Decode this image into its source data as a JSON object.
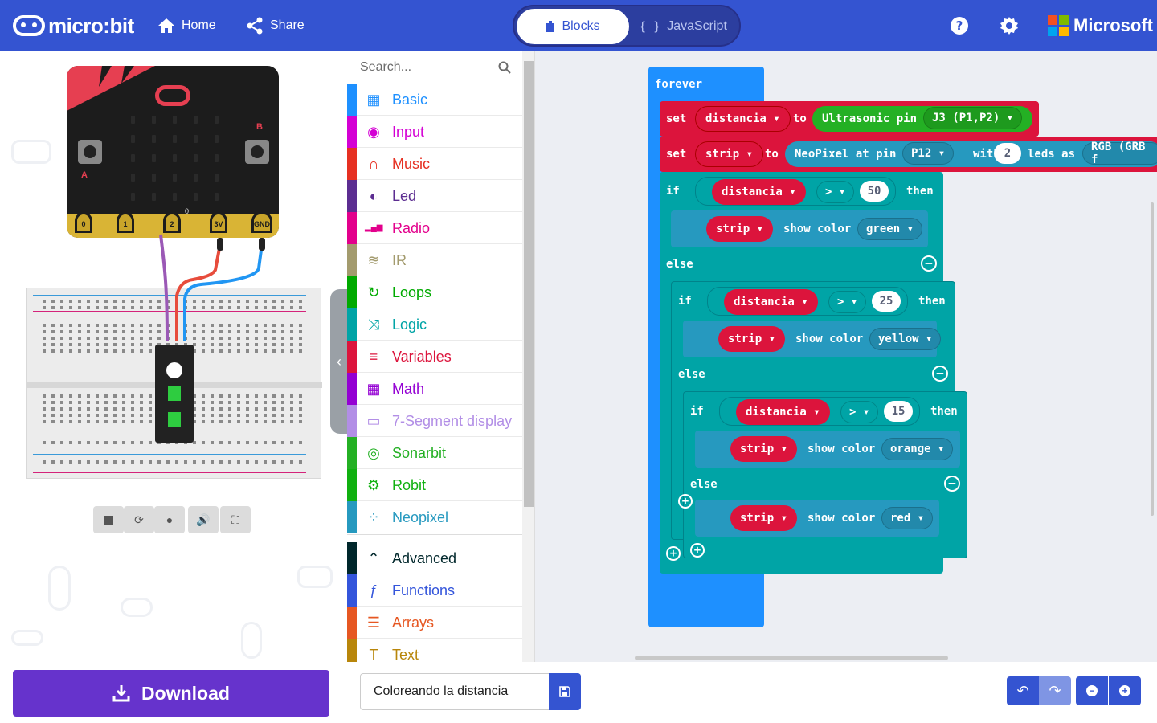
{
  "header": {
    "brand": "micro:bit",
    "home_label": "Home",
    "share_label": "Share",
    "tabs": [
      {
        "label": "Blocks",
        "active": true
      },
      {
        "label": "JavaScript",
        "active": false
      }
    ],
    "microsoft_label": "Microsoft",
    "colors": {
      "header_bg": "#3454d1",
      "toggle_active": "#ffffff"
    }
  },
  "simulator": {
    "pins": [
      "0",
      "1",
      "2",
      "3V",
      "GND"
    ],
    "button_a": "A",
    "button_b": "B",
    "pin_marker": "0"
  },
  "toolbox": {
    "search_placeholder": "Search...",
    "categories": [
      {
        "label": "Basic",
        "icon": "grid-icon",
        "color": "#1e90ff"
      },
      {
        "label": "Input",
        "icon": "target-icon",
        "color": "#d400d4"
      },
      {
        "label": "Music",
        "icon": "headphones-icon",
        "color": "#e63022"
      },
      {
        "label": "Led",
        "icon": "toggle-icon",
        "color": "#5c2d91"
      },
      {
        "label": "Radio",
        "icon": "signal-bars-icon",
        "color": "#e3008c"
      },
      {
        "label": "IR",
        "icon": "wifi-icon",
        "color": "#a39b6e"
      },
      {
        "label": "Loops",
        "icon": "refresh-icon",
        "color": "#00aa00"
      },
      {
        "label": "Logic",
        "icon": "shuffle-icon",
        "color": "#00a4a6"
      },
      {
        "label": "Variables",
        "icon": "list-lines-icon",
        "color": "#dc143c"
      },
      {
        "label": "Math",
        "icon": "calculator-icon",
        "color": "#9400d3"
      },
      {
        "label": "7-Segment display",
        "icon": "monitor-icon",
        "color": "#b28ee6"
      },
      {
        "label": "Sonarbit",
        "icon": "sonar-icon",
        "color": "#24b024"
      },
      {
        "label": "Robit",
        "icon": "gear-icon",
        "color": "#10b010"
      },
      {
        "label": "Neopixel",
        "icon": "dots-circle-icon",
        "color": "#2699bf"
      }
    ],
    "advanced": [
      {
        "label": "Advanced",
        "icon": "chevron-up-icon",
        "color": "#00272b"
      },
      {
        "label": "Functions",
        "icon": "fx-icon",
        "color": "#3455db"
      },
      {
        "label": "Arrays",
        "icon": "numbered-list-icon",
        "color": "#e65722"
      },
      {
        "label": "Text",
        "icon": "text-icon",
        "color": "#b8860b"
      }
    ]
  },
  "workspace": {
    "forever": "forever",
    "set1": {
      "set": "set",
      "var": "distancia",
      "to": "to",
      "fn": "Ultrasonic pin",
      "pin": "J3 (P1,P2)"
    },
    "set2": {
      "set": "set",
      "var": "strip",
      "to": "to",
      "fn": "NeoPixel at pin",
      "pin": "P12",
      "with": "with",
      "count": "2",
      "leds_as": "leds as",
      "mode": "RGB (GRB f"
    },
    "if1": {
      "if": "if",
      "var": "distancia",
      "op": ">",
      "value": "50",
      "then": "then",
      "strip": "strip",
      "show": "show color",
      "color": "green"
    },
    "else1": "else",
    "if2": {
      "if": "if",
      "var": "distancia",
      "op": ">",
      "value": "25",
      "then": "then",
      "strip": "strip",
      "show": "show color",
      "color": "yellow"
    },
    "else2": "else",
    "if3": {
      "if": "if",
      "var": "distancia",
      "op": ">",
      "value": "15",
      "then": "then",
      "strip": "strip",
      "show": "show color",
      "color": "orange"
    },
    "else3": "else",
    "else3_body": {
      "strip": "strip",
      "show": "show color",
      "color": "red"
    },
    "colors": {
      "event": "#1e90ff",
      "var": "#dc143c",
      "logic": "#00a4a6",
      "sonar": "#24b024",
      "neo": "#2699bf"
    }
  },
  "footer": {
    "download_label": "Download",
    "project_name": "Coloreando la distancia"
  }
}
